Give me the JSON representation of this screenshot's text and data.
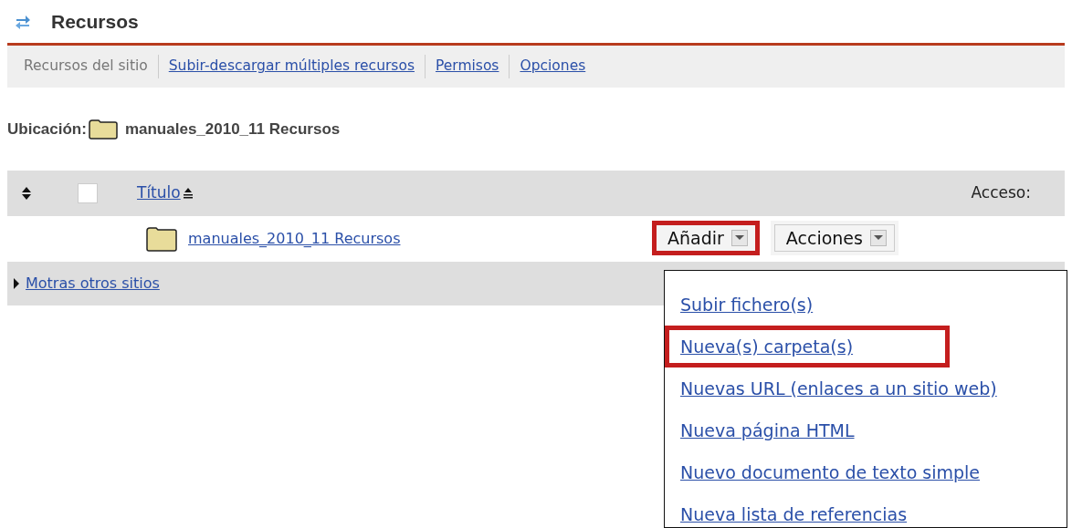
{
  "page": {
    "title": "Recursos"
  },
  "nav": [
    {
      "label": "Recursos del sitio",
      "selected": true
    },
    {
      "label": "Subir-descargar múltiples recursos",
      "selected": false
    },
    {
      "label": "Permisos",
      "selected": false
    },
    {
      "label": "Opciones",
      "selected": false
    }
  ],
  "location": {
    "label": "Ubicación:",
    "path": "manuales_2010_11 Recursos"
  },
  "table": {
    "select_all": {
      "checked": false
    },
    "title_column": "Título",
    "access_column": "Acceso:",
    "rows": [
      {
        "title": "manuales_2010_11 Recursos",
        "buttons": [
          {
            "label": "Añadir",
            "highlighted": true
          },
          {
            "label": "Acciones",
            "highlighted": false
          }
        ]
      }
    ]
  },
  "other_sites": {
    "label": "Motras otros sitios",
    "expanded": false
  },
  "add_menu": {
    "items": [
      {
        "label": "Subir fichero(s)",
        "highlighted": false
      },
      {
        "label": "Nueva(s) carpeta(s)",
        "highlighted": true
      },
      {
        "label": "Nuevas URL (enlaces a un sitio web)",
        "highlighted": false
      },
      {
        "label": "Nueva página HTML",
        "highlighted": false
      },
      {
        "label": "Nuevo documento de texto simple",
        "highlighted": false
      },
      {
        "label": "Nueva lista de referencias",
        "highlighted": false
      }
    ]
  }
}
